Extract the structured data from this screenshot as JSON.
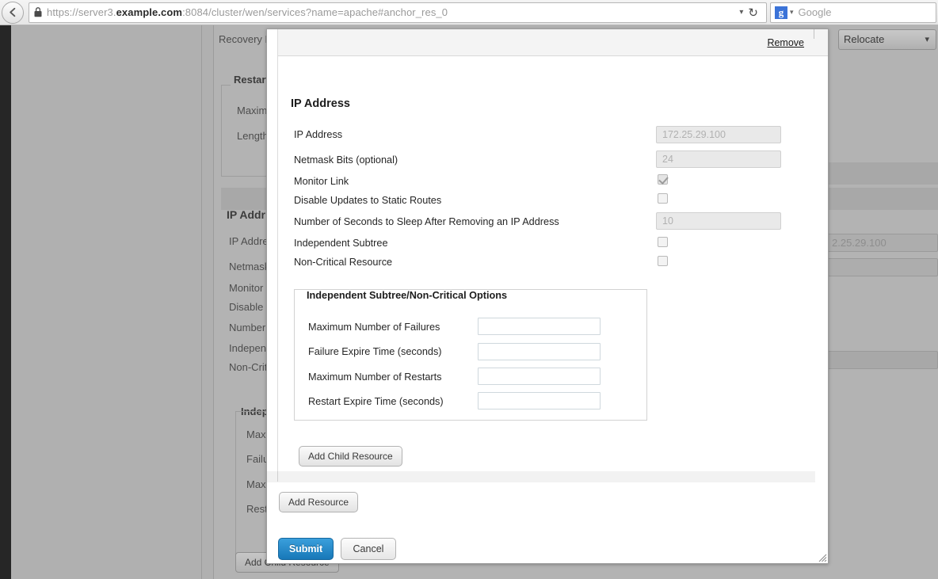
{
  "browser": {
    "back_icon": "back-arrow-icon",
    "lock_icon": "padlock-icon",
    "url_prefix": "https://server3.",
    "url_domain": "example.com",
    "url_suffix": ":8084/cluster/wen/services?name=apache#anchor_res_0",
    "url_dropdown_icon": "chevron-down-icon",
    "reload_icon": "reload-icon",
    "search_engine_glyph": "g",
    "search_engine_chevron": "chevron-down-icon",
    "search_placeholder": "Google"
  },
  "underlay": {
    "recovery_label": "Recovery P",
    "restart_legend": "Restart",
    "maximum_label": "Maximu",
    "length_label": "Length",
    "relocate_select": "Relocate",
    "section_title": "IP Addr",
    "labels": [
      "IP Addre",
      "Netmask",
      "Monitor L",
      "Disable",
      "Number",
      "Indepen",
      "Non-Crit"
    ],
    "subtree_legend": "Indep",
    "subtree_labels": [
      "Maxi",
      "Failu",
      "Maxi",
      "Rest"
    ],
    "ip_value": "2.25.29.100",
    "add_child_resource": "Add Child Resource"
  },
  "dialog": {
    "remove_link": "Remove",
    "section_title": "IP Address",
    "fields": [
      {
        "label": "IP Address",
        "type": "text",
        "value": "172.25.29.100"
      },
      {
        "label": "Netmask Bits (optional)",
        "type": "text",
        "value": "24"
      },
      {
        "label": "Monitor Link",
        "type": "checkbox",
        "checked": true
      },
      {
        "label": "Disable Updates to Static Routes",
        "type": "checkbox",
        "checked": false
      },
      {
        "label": "Number of Seconds to Sleep After Removing an IP Address",
        "type": "text",
        "value": "10"
      },
      {
        "label": "Independent Subtree",
        "type": "checkbox",
        "checked": false
      },
      {
        "label": "Non-Critical Resource",
        "type": "checkbox",
        "checked": false
      }
    ],
    "subtree": {
      "legend": "Independent Subtree/Non-Critical Options",
      "fields": [
        {
          "label": "Maximum Number of Failures",
          "value": ""
        },
        {
          "label": "Failure Expire Time (seconds)",
          "value": ""
        },
        {
          "label": "Maximum Number of Restarts",
          "value": ""
        },
        {
          "label": "Restart Expire Time (seconds)",
          "value": ""
        }
      ]
    },
    "add_child_resource": "Add Child Resource",
    "add_resource": "Add Resource",
    "submit": "Submit",
    "cancel": "Cancel",
    "resize_grip_icon": "resize-grip-icon"
  },
  "colors": {
    "accent": "#1878b8",
    "overlay": "#b0b0b0",
    "dialog_bg": "#ffffff"
  }
}
